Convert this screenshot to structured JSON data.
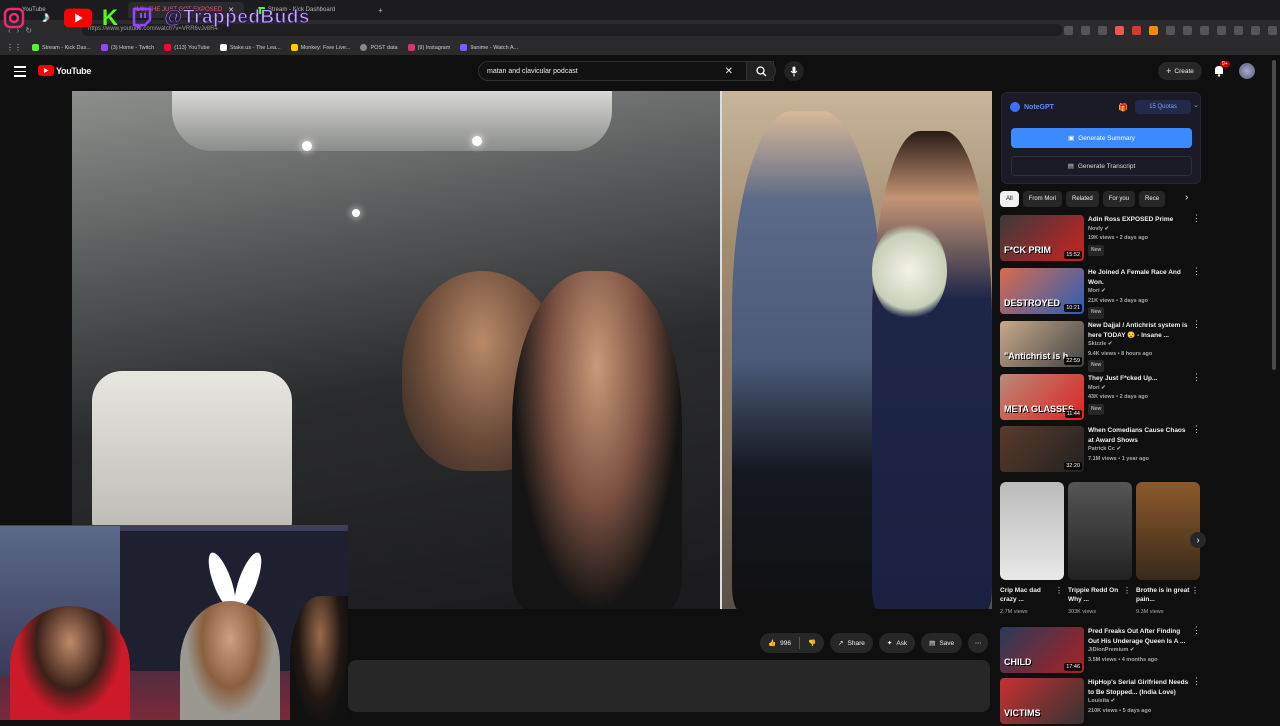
{
  "browser": {
    "tabs": [
      {
        "label": "YouTube",
        "active": false
      },
      {
        "label": "(1/9) SHE JUST GOT EXPOSED",
        "active": true
      },
      {
        "label": "Stream - Kick Dashboard",
        "active": false
      }
    ],
    "new_tab": "+",
    "url": "https://www.youtube.com/watch?v=VRR6vJv8R4",
    "bookmarks": [
      {
        "label": "Stream - Kick Das...",
        "color": "#53fc18"
      },
      {
        "label": "(3) Home - Twitch",
        "color": "#9146ff"
      },
      {
        "label": "(113) YouTube",
        "color": "#ff0033"
      },
      {
        "label": "Stake.us - The Lea...",
        "color": "#1a2c38"
      },
      {
        "label": "Monkey: Free Live...",
        "color": "#ffcc00"
      },
      {
        "label": "POST data",
        "color": "#888888"
      },
      {
        "label": "(9) Instagram",
        "color": "#e1306c"
      },
      {
        "label": "9anime - Watch A...",
        "color": "#7b5cff"
      }
    ]
  },
  "overlay": {
    "handle": "@TrappedBuds",
    "icons": [
      "instagram-icon",
      "tiktok-icon",
      "youtube-icon",
      "kick-icon",
      "twitch-icon"
    ]
  },
  "youtube": {
    "logo": "YouTube",
    "search_query": "matan and clavicular podcast",
    "create_label": "Create",
    "notifications": "9+"
  },
  "video": {
    "actions": {
      "likes": "996",
      "share": "Share",
      "ask": "Ask",
      "save": "Save"
    }
  },
  "notegpt": {
    "title": "NoteGPT",
    "quotas": "15 Quotas",
    "generate_summary": "Generate Summary",
    "generate_transcript": "Generate Transcript"
  },
  "chips": [
    "All",
    "From Mori",
    "Related",
    "For you",
    "Rece"
  ],
  "recommendations": [
    {
      "title": "Adin Ross EXPOSED Prime",
      "channel": "Novly",
      "meta": "19K views • 2 days ago",
      "badge": "New",
      "duration": "15:52",
      "thumb_text": "F*CK PRIM",
      "colors": [
        "#3a3a3a",
        "#c22"
      ]
    },
    {
      "title": "He Joined A Female Race And Won.",
      "channel": "Mori",
      "meta": "21K views • 3 days ago",
      "badge": "New",
      "duration": "10:21",
      "thumb_text": "DESTROYED",
      "colors": [
        "#d86b4a",
        "#2a5fb8"
      ]
    },
    {
      "title": "New Dajjal / Antichrist system is here TODAY 😯 - Insane ...",
      "channel": "Skizzle",
      "meta": "9.4K views • 8 hours ago",
      "badge": "New",
      "duration": "22:59",
      "thumb_text": "\"Antichrist is h",
      "colors": [
        "#c9a98a",
        "#444"
      ]
    },
    {
      "title": "They Just F*cked Up...",
      "channel": "Mori",
      "meta": "43K views • 2 days ago",
      "badge": "New",
      "duration": "11:44",
      "thumb_text": "META GLASSES",
      "colors": [
        "#b98b78",
        "#d22"
      ]
    },
    {
      "title": "When Comedians Cause Chaos at Award Shows",
      "channel": "Patrick Cc",
      "meta": "7.1M views • 1 year ago",
      "badge": "",
      "duration": "32:20",
      "thumb_text": "",
      "colors": [
        "#5a3a2a",
        "#222"
      ]
    }
  ],
  "shorts": [
    {
      "title": "Crip Mac dad crazy ...",
      "views": "2.7M views",
      "colors": [
        "#bbbbbb",
        "#e8e8e8"
      ]
    },
    {
      "title": "Trippie Redd On Why ...",
      "views": "303K views",
      "colors": [
        "#555",
        "#222"
      ]
    },
    {
      "title": "Brothe is in great pain...",
      "views": "9.3M views",
      "colors": [
        "#8b5a2b",
        "#3a2a1a"
      ]
    }
  ],
  "recommendations_2": [
    {
      "title": "Pred Freaks Out After Finding Out His Underage Queen Is A ...",
      "channel": "JiDionPremium",
      "meta": "3.5M views • 4 months ago",
      "duration": "17:46",
      "thumb_text": "CHILD",
      "colors": [
        "#2a3a5a",
        "#aa2222"
      ]
    },
    {
      "title": "HipHop's Serial Girlfriend Needs to Be Stopped... (India Love)",
      "channel": "Louisita",
      "meta": "210K views • 5 days ago",
      "duration": "",
      "thumb_text": "VICTIMS",
      "colors": [
        "#c83030",
        "#333"
      ]
    }
  ]
}
